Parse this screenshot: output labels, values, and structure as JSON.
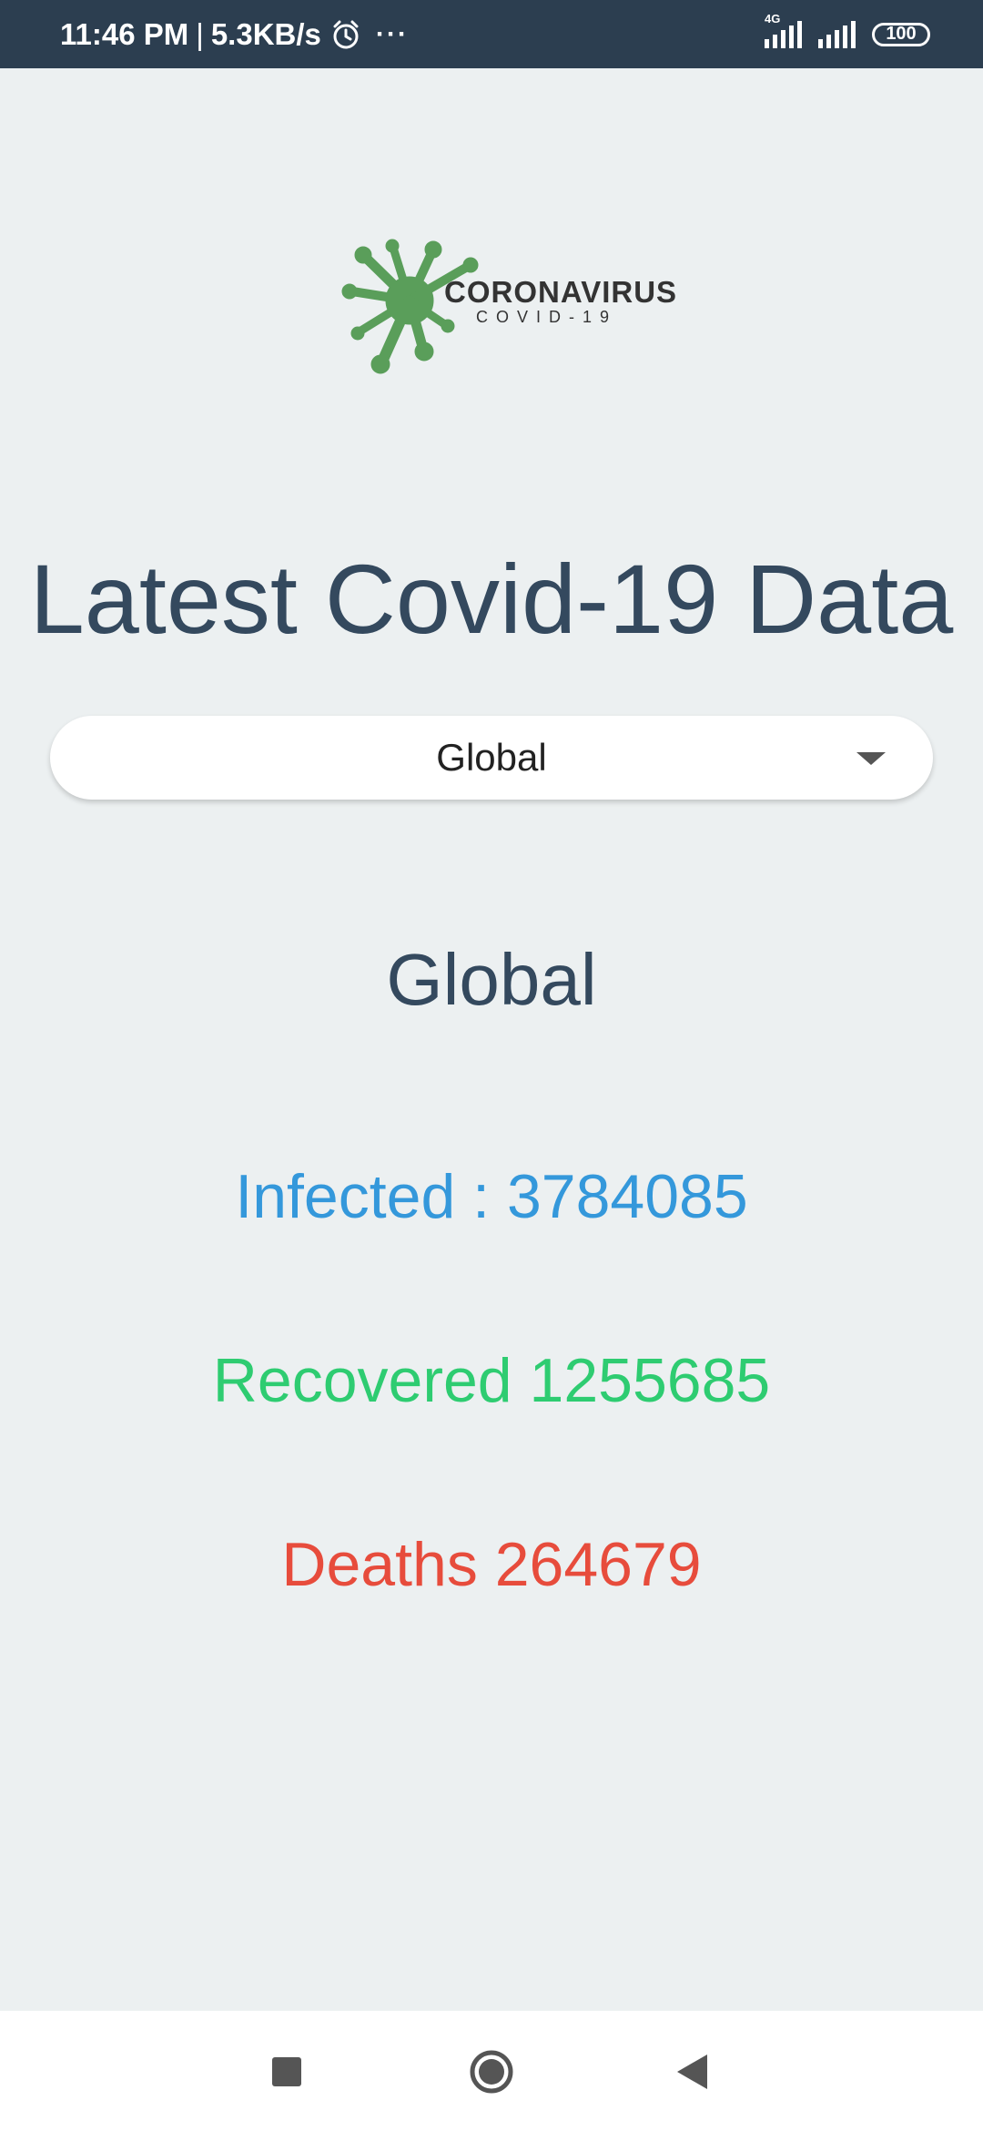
{
  "status_bar": {
    "time": "11:46 PM",
    "separator": "|",
    "speed": "5.3KB/s",
    "alarm_icon": "alarm-clock-icon",
    "more_icon": "dots",
    "more_label": "···",
    "network_label": "4G",
    "battery": "100"
  },
  "logo": {
    "title": "CORONAVIRUS",
    "subtitle": "COVID-19",
    "color": "#5a9e5a"
  },
  "page": {
    "title": "Latest Covid-19 Data"
  },
  "dropdown": {
    "selected": "Global"
  },
  "stats": {
    "region": "Global",
    "infected": "Infected : 3784085",
    "recovered": "Recovered 1255685",
    "deaths": "Deaths 264679"
  },
  "colors": {
    "status_bar": "#2c3e50",
    "background": "#ecf0f1",
    "heading": "#34495e",
    "infected": "#3498db",
    "recovered": "#2ecc71",
    "deaths": "#e74c3c"
  },
  "nav": {
    "recents_icon": "square-icon",
    "home_icon": "circle-icon",
    "back_icon": "triangle-back-icon"
  }
}
